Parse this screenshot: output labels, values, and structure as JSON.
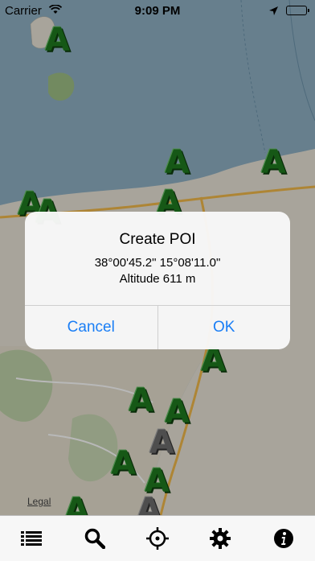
{
  "status_bar": {
    "carrier": "Carrier",
    "time": "9:09 PM"
  },
  "map": {
    "legal_label": "Legal",
    "poi_markers": [
      {
        "glyph": "A",
        "color": "green"
      },
      {
        "glyph": "A",
        "color": "green"
      },
      {
        "glyph": "A",
        "color": "green"
      },
      {
        "glyph": "A",
        "color": "green"
      },
      {
        "glyph": "A",
        "color": "green"
      },
      {
        "glyph": "A",
        "color": "green"
      },
      {
        "glyph": "A",
        "color": "green"
      },
      {
        "glyph": "A",
        "color": "green"
      },
      {
        "glyph": "A",
        "color": "green"
      },
      {
        "glyph": "A",
        "color": "gray"
      },
      {
        "glyph": "A",
        "color": "green"
      },
      {
        "glyph": "A",
        "color": "green"
      },
      {
        "glyph": "A",
        "color": "green"
      },
      {
        "glyph": "A",
        "color": "gray"
      }
    ]
  },
  "dialog": {
    "title": "Create POI",
    "coordinates": "38°00'45.2\" 15°08'11.0\"",
    "altitude": "Altitude 611 m",
    "cancel_label": "Cancel",
    "ok_label": "OK"
  },
  "toolbar": {
    "items": [
      {
        "icon": "list-icon"
      },
      {
        "icon": "search-icon"
      },
      {
        "icon": "crosshair-icon"
      },
      {
        "icon": "gear-icon"
      },
      {
        "icon": "info-icon"
      }
    ]
  },
  "colors": {
    "sea": "#8fb0c4",
    "land": "#e9e4d7",
    "accent": "#1a7ef5",
    "poi_green": "#1f7a1f",
    "poi_gray": "#6d6d6d"
  }
}
